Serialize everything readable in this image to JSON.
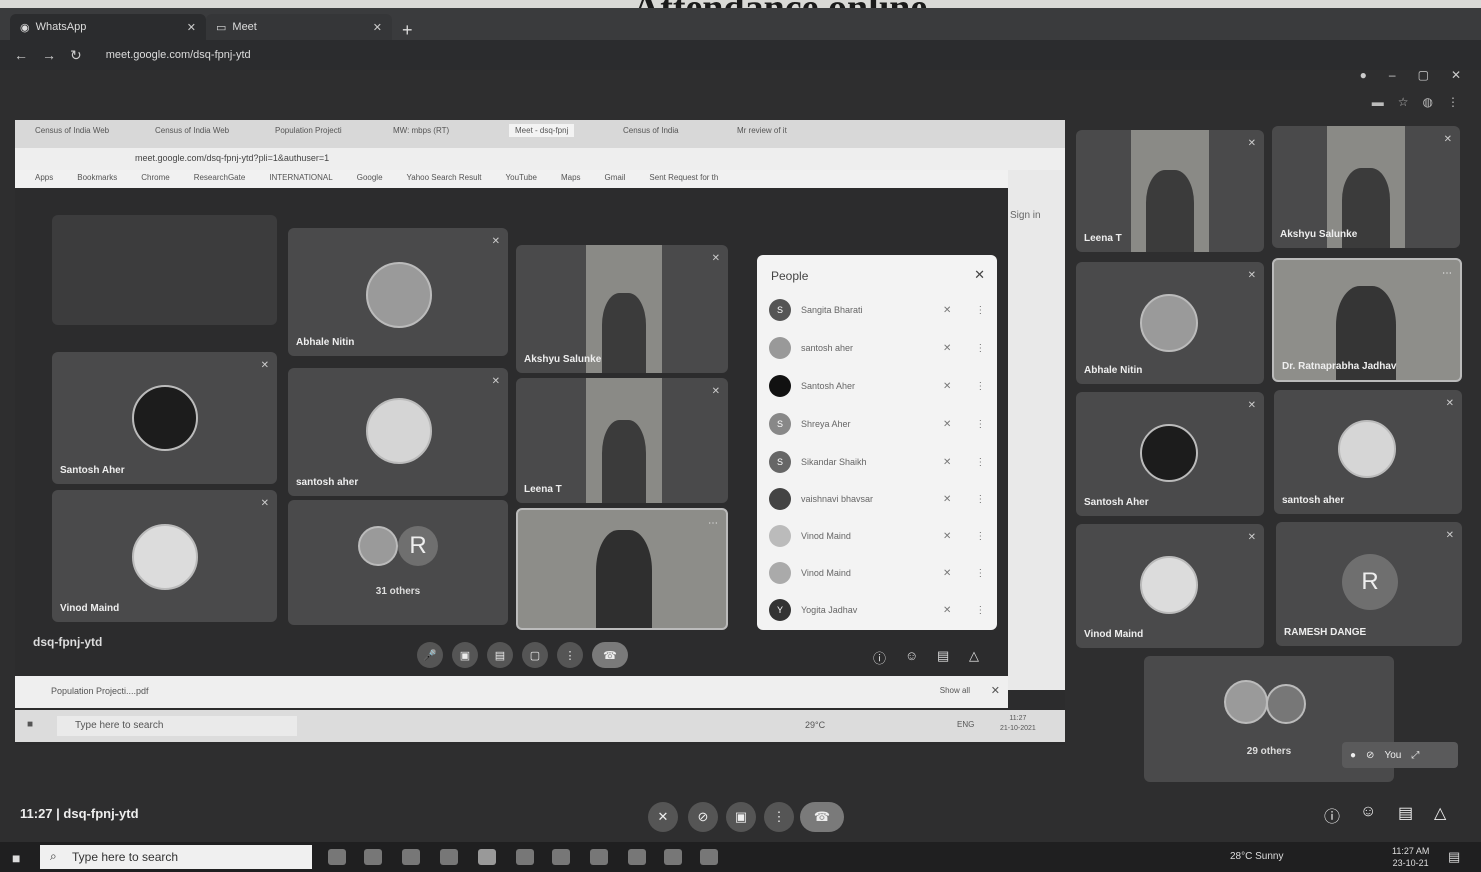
{
  "heading": "Attendance online",
  "outer_browser": {
    "tabs": [
      {
        "label": "WhatsApp"
      },
      {
        "label": "Meet"
      }
    ],
    "url": "meet.google.com/dsq-fpnj-ytd"
  },
  "inner_browser": {
    "tabs": [
      "Census of India Web",
      "Census of India Web",
      "Population Projecti",
      "MW: mbps (RT)",
      "Meet - dsq-fpnj",
      "Census of India",
      "Mr review of it"
    ],
    "url": "meet.google.com/dsq-fpnj-ytd?pli=1&authuser=1",
    "bookmarks": [
      "Apps",
      "Bookmarks",
      "Chrome",
      "ResearchGate",
      "INTERNATIONAL",
      "Google",
      "Yahoo Search Result",
      "YouTube",
      "Maps",
      "Gmail",
      "Sent Request for th"
    ],
    "sign_in": "Sign in",
    "meeting_code": "dsq-fpnj-ytd",
    "tiles": [
      {
        "name": "Abhale Nitin"
      },
      {
        "name": "Akshyu Salunke"
      },
      {
        "name": "Santosh Aher"
      },
      {
        "name": "santosh aher"
      },
      {
        "name": "Leena T"
      },
      {
        "name": "Vinod Maind"
      },
      {
        "name": "31 others",
        "initial": "R"
      }
    ],
    "people_panel": {
      "title": "People",
      "members": [
        {
          "name": "Sangita Bharati",
          "initial": "S"
        },
        {
          "name": "santosh aher",
          "initial": ""
        },
        {
          "name": "Santosh Aher",
          "initial": ""
        },
        {
          "name": "Shreya Aher",
          "initial": "S"
        },
        {
          "name": "Sikandar Shaikh",
          "initial": "S"
        },
        {
          "name": "vaishnavi bhavsar",
          "initial": ""
        },
        {
          "name": "Vinod Maind",
          "initial": ""
        },
        {
          "name": "Vinod Maind",
          "initial": ""
        },
        {
          "name": "Yogita Jadhav",
          "initial": "Y"
        }
      ]
    },
    "download_file": "Population Projecti....pdf",
    "show_all": "Show all",
    "taskbar_search": "Type here to search",
    "weather": "29°C",
    "lang": "ENG",
    "time": "11:27",
    "date": "21-10-2021"
  },
  "outer_tiles": [
    {
      "name": "Leena T"
    },
    {
      "name": "Akshyu Salunke"
    },
    {
      "name": "Abhale Nitin"
    },
    {
      "name": "Dr. Ratnaprabha Jadhav"
    },
    {
      "name": "Santosh Aher"
    },
    {
      "name": "santosh aher"
    },
    {
      "name": "Vinod Maind"
    },
    {
      "name": "RAMESH DANGE",
      "initial": "R"
    },
    {
      "name": "29 others"
    }
  ],
  "self_view_label": "You",
  "meeting": {
    "time": "11:27",
    "code": "dsq-fpnj-ytd"
  },
  "taskbar": {
    "search_placeholder": "Type here to search",
    "weather": "28°C Sunny",
    "time": "11:27 AM",
    "date": "23-10-21"
  },
  "colors": {
    "stage": "#2e2e2f",
    "tile": "#4a4a4b",
    "end_call": "#7a7a7a"
  }
}
